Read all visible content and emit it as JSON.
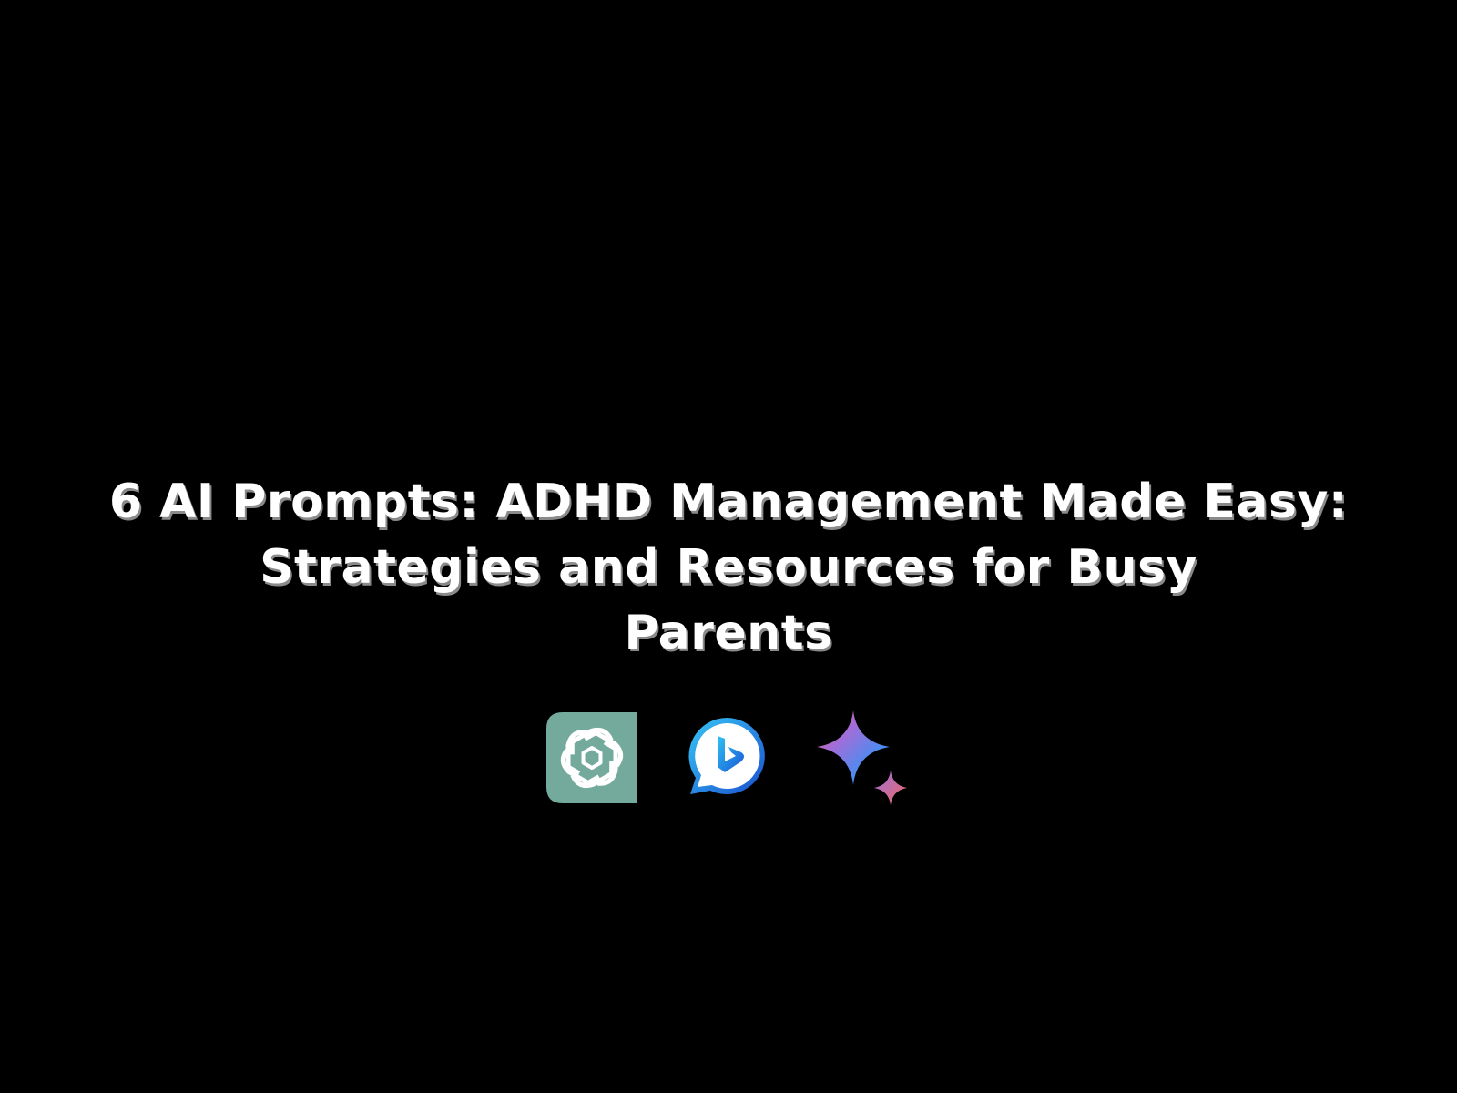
{
  "title": {
    "line1": "6 AI Prompts: ADHD Management Made Easy:",
    "line2": "Strategies and Resources for Busy",
    "line3": "Parents"
  },
  "logos": [
    {
      "icon": "chatgpt-logo-icon",
      "color": "#74aa9c"
    },
    {
      "icon": "bing-chat-logo-icon",
      "color": "#1b6fd8"
    },
    {
      "icon": "gemini-sparkle-logo-icon",
      "color": "#4b8cf0"
    }
  ]
}
